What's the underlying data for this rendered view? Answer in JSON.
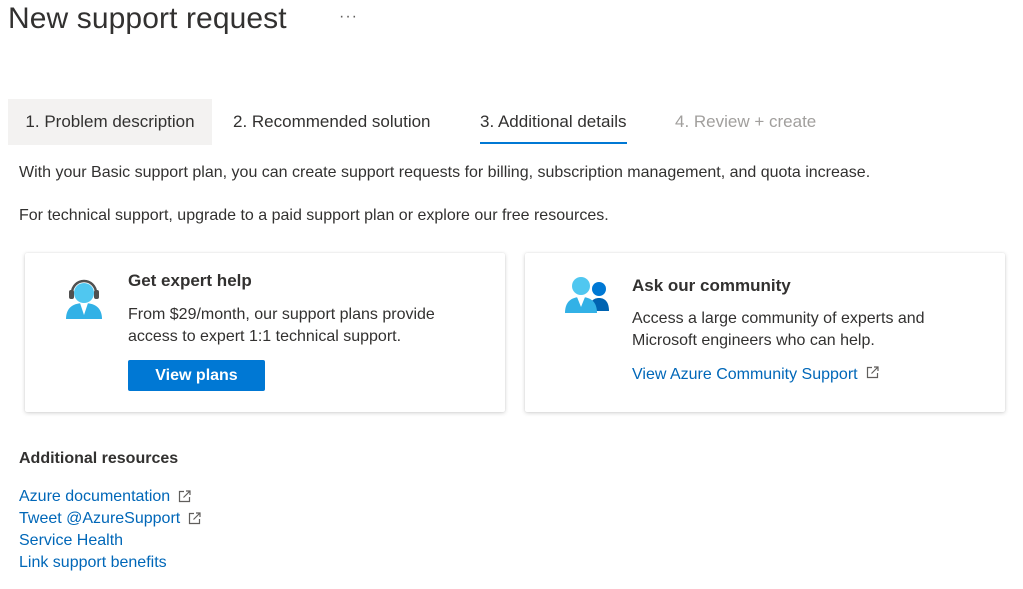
{
  "header": {
    "title": "New support request",
    "more": "···"
  },
  "tabs": [
    {
      "label": "1. Problem description",
      "state": "visited"
    },
    {
      "label": "2. Recommended solution",
      "state": "normal"
    },
    {
      "label": "3. Additional details",
      "state": "active"
    },
    {
      "label": "4. Review + create",
      "state": "disabled"
    }
  ],
  "intro": {
    "line1": "With your Basic support plan, you can create support requests for billing, subscription management, and quota increase.",
    "line2": "For technical support, upgrade to a paid support plan or explore our free resources."
  },
  "cards": {
    "expert": {
      "icon": "headset-agent-icon",
      "title": "Get expert help",
      "description": "From $29/month, our support plans provide access to expert 1:1 technical support.",
      "button_label": "View plans"
    },
    "community": {
      "icon": "community-people-icon",
      "title": "Ask our community",
      "description": "Access a large community of experts and Microsoft engineers who can help.",
      "link_label": "View Azure Community Support"
    }
  },
  "resources": {
    "title": "Additional resources",
    "links": [
      {
        "label": "Azure documentation",
        "external": true
      },
      {
        "label": "Tweet @AzureSupport",
        "external": true
      },
      {
        "label": "Service Health",
        "external": false
      },
      {
        "label": "Link support benefits",
        "external": false
      }
    ]
  },
  "colors": {
    "accent": "#0078d4",
    "link": "#0067b8",
    "text": "#323130",
    "disabled": "#a19f9d",
    "tab_visited_bg": "#f3f2f1"
  }
}
